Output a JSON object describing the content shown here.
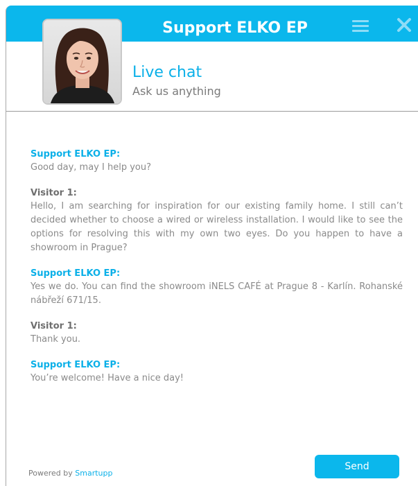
{
  "header": {
    "title": "Support ELKO EP",
    "background_color": "#0bb7ec",
    "menu_icon": "menu-icon",
    "close_icon": "close-icon"
  },
  "agent": {
    "avatar_icon": "agent-avatar-photo",
    "title": "Live chat",
    "subtitle": "Ask us anything",
    "title_color": "#0bb0e8"
  },
  "messages": [
    {
      "author": "Support ELKO EP:",
      "role": "support",
      "text": "Good day, may I help you?"
    },
    {
      "author": "Visitor 1:",
      "role": "visitor",
      "text": "Hello, I am searching for inspiration for our existing family home. I still can’t decided whether to choose a wired or wireless installation. I would like to see the options for resolving this with my own two eyes. Do you happen to have a showroom in Prague?"
    },
    {
      "author": "Support ELKO EP:",
      "role": "support",
      "text": "Yes we do. You can find the showroom iNELS CAFÉ at Prague 8 - Karlín. Rohanské nábřeží 671/15."
    },
    {
      "author": "Visitor 1:",
      "role": "visitor",
      "text": "Thank you."
    },
    {
      "author": "Support ELKO EP:",
      "role": "support",
      "text": "You’re welcome! Have a nice day!"
    }
  ],
  "footer": {
    "powered_prefix": "Powered by ",
    "powered_link": "Smartupp",
    "send_label": "Send"
  }
}
